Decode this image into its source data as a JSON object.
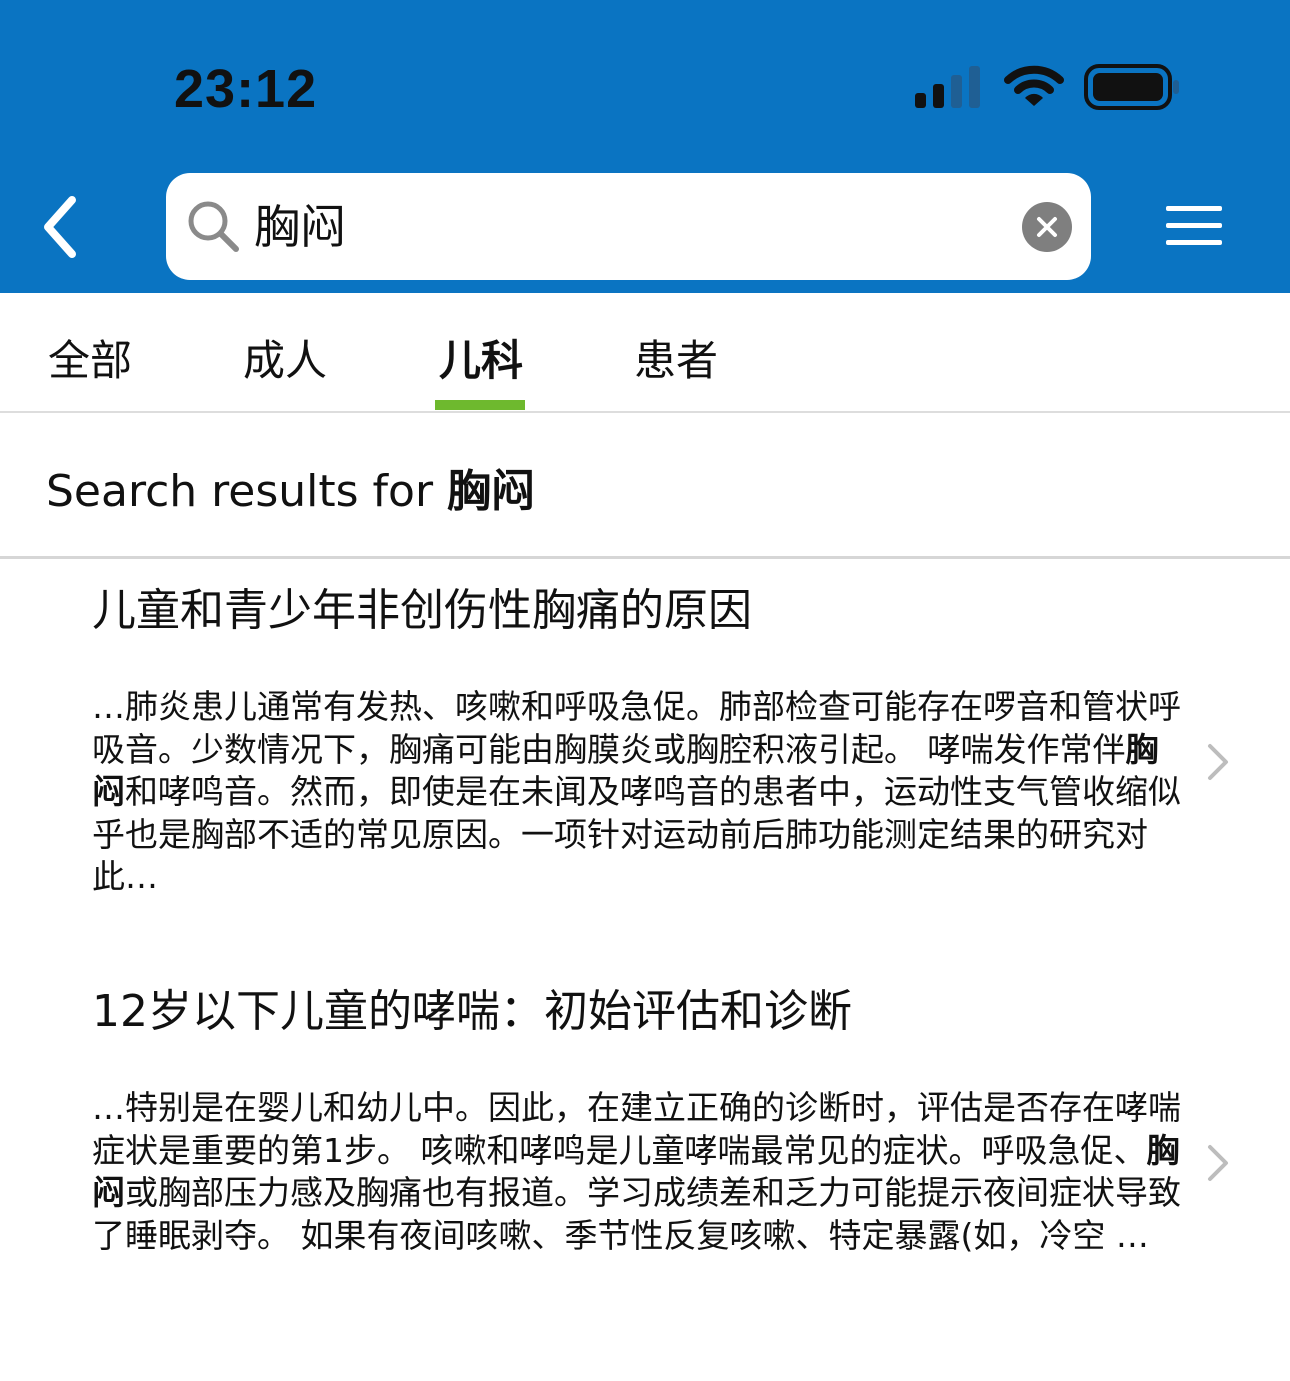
{
  "status_bar": {
    "time": "23:12"
  },
  "search": {
    "query": "胸闷"
  },
  "tabs": [
    {
      "label": "全部"
    },
    {
      "label": "成人"
    },
    {
      "label": "儿科"
    },
    {
      "label": "患者"
    }
  ],
  "results_header": {
    "prefix": "Search results for ",
    "term": "胸闷"
  },
  "results": [
    {
      "title": "儿童和青少年非创伤性胸痛的原因",
      "snippet_before": "…肺炎患儿通常有发热、咳嗽和呼吸急促。肺部检查可能存在啰音和管状呼吸音。少数情况下，胸痛可能由胸膜炎或胸腔积液引起。 哮喘发作常伴",
      "snippet_highlight": "胸闷",
      "snippet_after": "和哮鸣音。然而，即使是在未闻及哮鸣音的患者中，运动性支气管收缩似乎也是胸部不适的常见原因。一项针对运动前后肺功能测定结果的研究对此…"
    },
    {
      "title": "12岁以下儿童的哮喘：初始评估和诊断",
      "snippet_before": "…特别是在婴儿和幼儿中。因此，在建立正确的诊断时，评估是否存在哮喘症状是重要的第1步。 咳嗽和哮鸣是儿童哮喘最常见的症状。呼吸急促、",
      "snippet_highlight": "胸闷",
      "snippet_after": "或胸部压力感及胸痛也有报道。学习成绩差和乏力可能提示夜间症状导致了睡眠剥夺。 如果有夜间咳嗽、季节性反复咳嗽、特定暴露(如，冷空 …"
    }
  ],
  "icons": {
    "back": "chevron-left-icon",
    "search": "magnifier-icon",
    "clear": "clear-x-icon",
    "menu": "hamburger-menu-icon",
    "result_chevron": "chevron-right-icon"
  },
  "colors": {
    "header_blue": "#0A74C2",
    "active_tab_indicator": "#6EB92E"
  }
}
